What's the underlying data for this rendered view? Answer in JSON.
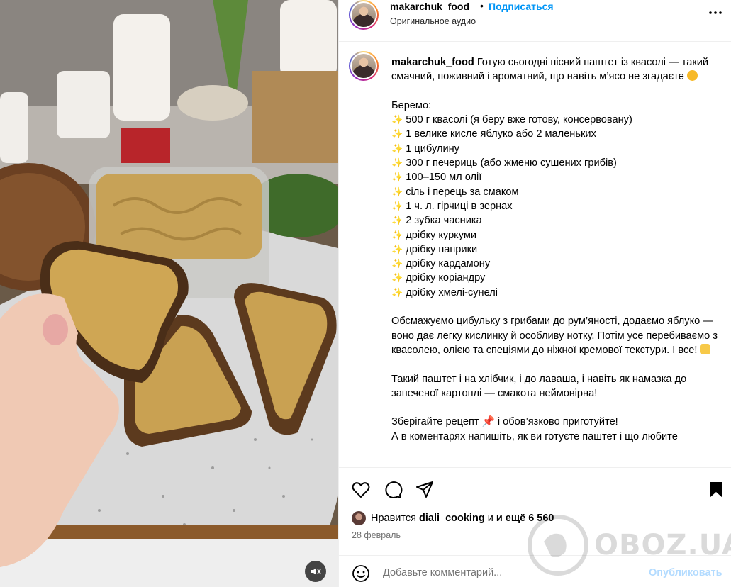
{
  "post": {
    "username": "makarchuk_food",
    "separator": "•",
    "follow_label": "Подписаться",
    "audio": "Оригинальное аудио",
    "more_icon": "more-horizontal-icon"
  },
  "caption": {
    "username": "makarchuk_food",
    "intro": "Готую сьогодні пісний паштет із квасолі — такий смачний, поживний і ароматний, що навіть м’ясо не згадаєте",
    "intro_emoji": "smiling-face-emoji",
    "list_title": "Беремо:",
    "bullet_icon": "sparkles-emoji",
    "ingredients": [
      "500 г квасолі (я беру вже готову, консервовану)",
      "1 велике кисле яблуко або 2 маленьких",
      "1 цибулину",
      "300 г печериць (або жменю сушених грибів)",
      "100–150 мл олії",
      "сіль і перець за смаком",
      "1 ч. л. гірчиці в зернах",
      "2 зубка часника",
      "дрібку куркуми",
      "дрібку паприки",
      "дрібку кардамону",
      "дрібку коріандру",
      "дрібку хмелі-сунелі"
    ],
    "method": "Обсмажуємо цибульку з грибами до рум’яності, додаємо яблуко — воно дає легку кислинку й особливу нотку. Потім усе перебиваємо з квасолею, олією та спеціями до ніжної кремової текстури. І все!",
    "method_emoji": "raising-hands-emoji",
    "serving": "Такий паштет і на хлібчик, і до лаваша, і навіть як намазка до запеченої картоплі — смакота неймовірна!",
    "save_text": "Зберігайте рецепт",
    "save_emoji": "pushpin-emoji",
    "save_text_end": "і обов’язково приготуйте!",
    "last_line": "А в коментарях напишіть, як ви готуєте паштет і що любите"
  },
  "actions": {
    "icons": [
      "heart-icon",
      "comment-icon",
      "share-icon",
      "bookmark-icon"
    ]
  },
  "likes": {
    "prefix": "Нравится",
    "user": "diali_cooking",
    "and_more": "и ещё 6 560"
  },
  "date": "28 февраль",
  "comment_box": {
    "placeholder": "Добавьте комментарий...",
    "post_label": "Опубликовать"
  },
  "watermark": {
    "text": "OBOZ.UA"
  },
  "colors": {
    "accent": "#0095f6",
    "post_disabled": "#b3dbff",
    "muted": "#737373",
    "sparkle": "#f7b928"
  }
}
